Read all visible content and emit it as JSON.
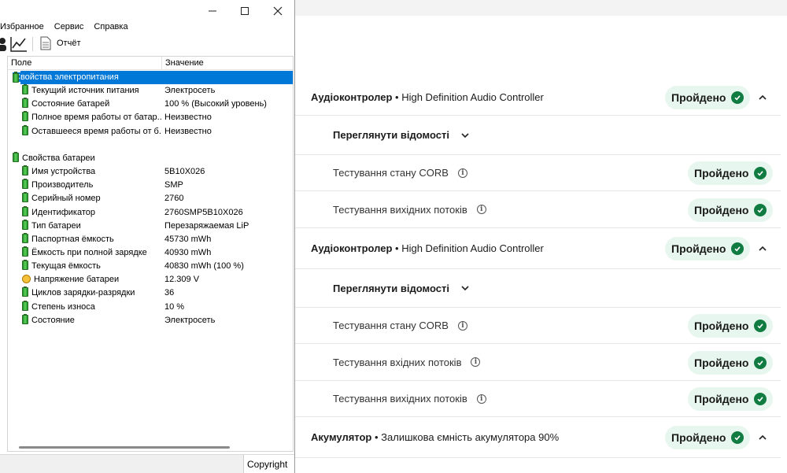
{
  "window": {
    "menu": [
      "Избранное",
      "Сервис",
      "Справка"
    ],
    "toolbar_report": "Отчёт",
    "columns": {
      "field": "Поле",
      "value": "Значение"
    },
    "status_text": "Copyright",
    "rows": [
      {
        "name": "Свойства электропитания",
        "value": "",
        "kind": "group",
        "selected": true
      },
      {
        "name": "Текущий источник питания",
        "value": "Электросеть",
        "kind": "item"
      },
      {
        "name": "Состояние батарей",
        "value": "100 % (Высокий уровень)",
        "kind": "item"
      },
      {
        "name": "Полное время работы от батар...",
        "value": "Неизвестно",
        "kind": "item"
      },
      {
        "name": "Оставшееся время работы от б...",
        "value": "Неизвестно",
        "kind": "item"
      },
      {
        "name": "",
        "value": "",
        "kind": "blank"
      },
      {
        "name": "Свойства батареи",
        "value": "",
        "kind": "group"
      },
      {
        "name": "Имя устройства",
        "value": "5B10X026",
        "kind": "item"
      },
      {
        "name": "Производитель",
        "value": "SMP",
        "kind": "item"
      },
      {
        "name": "Серийный номер",
        "value": "2760",
        "kind": "item"
      },
      {
        "name": "Идентификатор",
        "value": "2760SMP5B10X026",
        "kind": "item"
      },
      {
        "name": "Тип батареи",
        "value": "Перезаряжаемая LiP",
        "kind": "item"
      },
      {
        "name": "Паспортная ёмкость",
        "value": "45730 mWh",
        "kind": "item"
      },
      {
        "name": "Ёмкость при полной зарядке",
        "value": "40930 mWh",
        "kind": "item"
      },
      {
        "name": "Текущая ёмкость",
        "value": "40830 mWh  (100 %)",
        "kind": "item"
      },
      {
        "name": "Напряжение батареи",
        "value": "12.309 V",
        "kind": "bolt"
      },
      {
        "name": "Циклов зарядки-разрядки",
        "value": "36",
        "kind": "item"
      },
      {
        "name": "Степень износа",
        "value": "10 %",
        "kind": "item"
      },
      {
        "name": "Состояние",
        "value": "Электросеть",
        "kind": "item"
      }
    ]
  },
  "diagnostics": {
    "rows": [
      {
        "type": "section",
        "title_bold": "Аудіоконтролер",
        "sep": " • ",
        "title_rest": "High Definition Audio Controller",
        "status": "Пройдено"
      },
      {
        "type": "details",
        "label": "Переглянути відомості"
      },
      {
        "type": "test",
        "label": "Тестування стану CORB",
        "status": "Пройдено"
      },
      {
        "type": "test",
        "label": "Тестування вихідних потоків",
        "status": "Пройдено"
      },
      {
        "type": "section",
        "title_bold": "Аудіоконтролер",
        "sep": " • ",
        "title_rest": "High Definition Audio Controller",
        "status": "Пройдено"
      },
      {
        "type": "details",
        "label": "Переглянути відомості"
      },
      {
        "type": "test",
        "label": "Тестування стану CORB",
        "status": "Пройдено"
      },
      {
        "type": "test",
        "label": "Тестування вхідних потоків",
        "status": "Пройдено"
      },
      {
        "type": "test",
        "label": "Тестування вихідних потоків",
        "status": "Пройдено"
      },
      {
        "type": "section",
        "title_bold": "Акумулятор",
        "sep": " • ",
        "title_rest": "Залишкова ємність акумулятора 90%",
        "status": "Пройдено"
      }
    ]
  },
  "colors": {
    "pass_green": "#107c41",
    "pill_bg": "#e7f6ee",
    "selection_blue": "#0078d7"
  }
}
